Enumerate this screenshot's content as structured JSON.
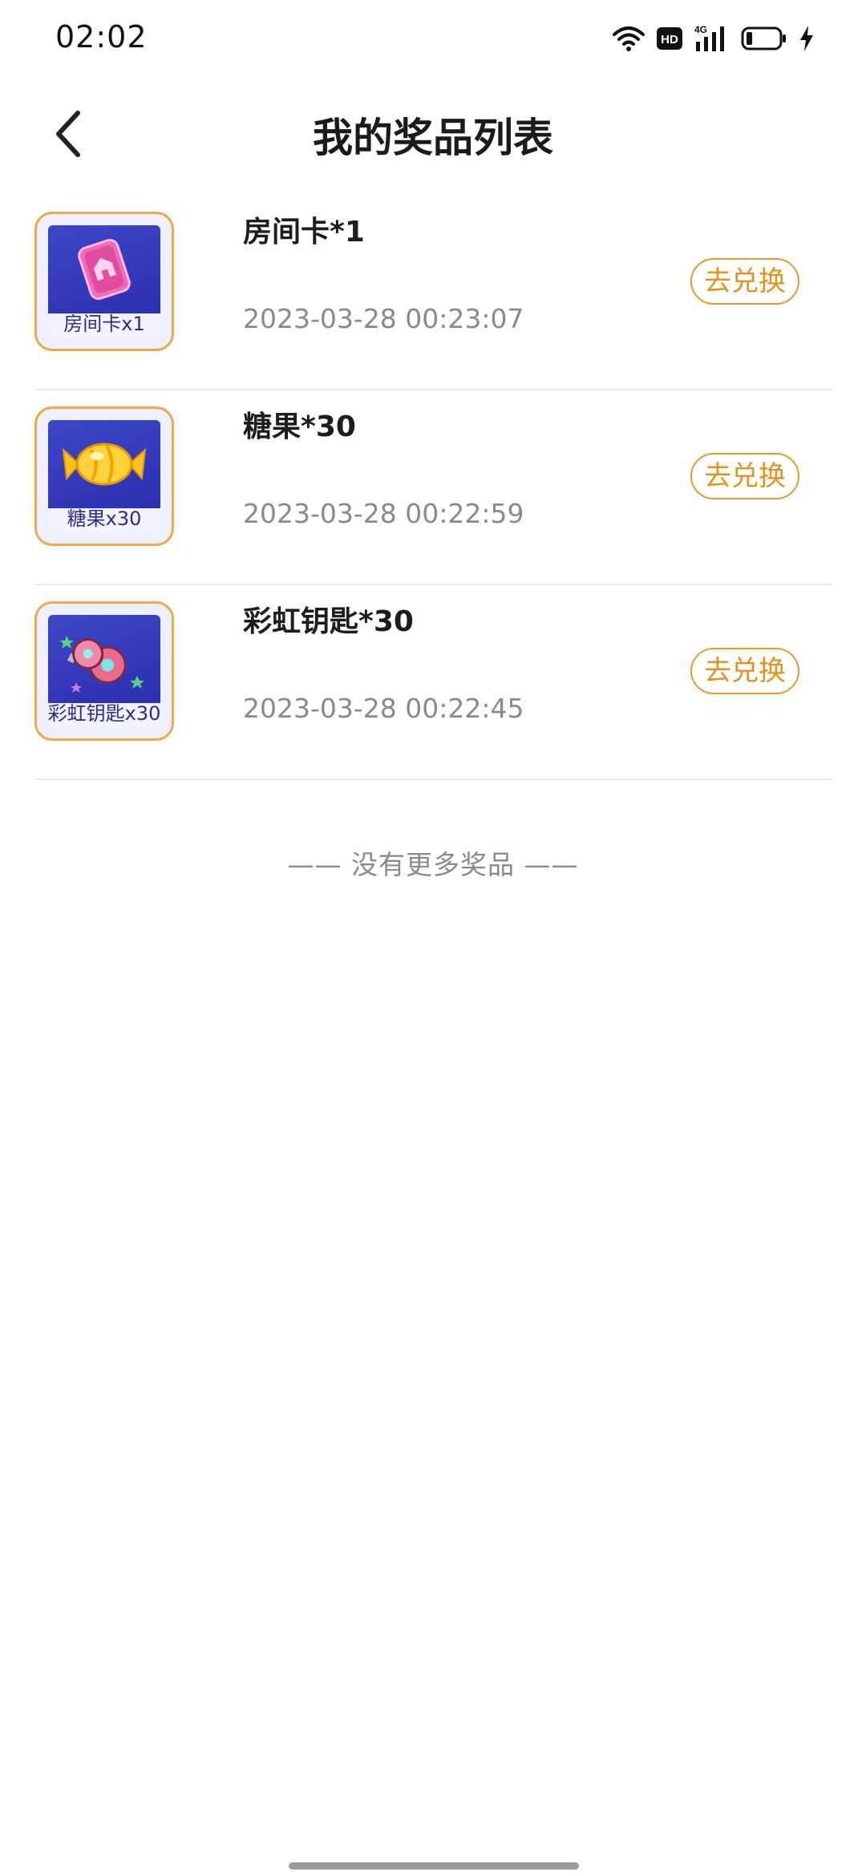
{
  "status_bar": {
    "time": "02:02",
    "icons": [
      "wifi-icon",
      "hd-icon",
      "signal-4g-icon",
      "battery-icon",
      "charging-icon"
    ],
    "hd_label": "HD",
    "network_label": "4G"
  },
  "header": {
    "back_icon": "chevron-left-icon",
    "title": "我的奖品列表"
  },
  "prizes": [
    {
      "name": "房间卡*1",
      "thumb_caption": "房间卡x1",
      "time": "2023-03-28 00:23:07",
      "action": "去兑换",
      "icon": "room-card-icon"
    },
    {
      "name": "糖果*30",
      "thumb_caption": "糖果x30",
      "time": "2023-03-28 00:22:59",
      "action": "去兑换",
      "icon": "candy-icon"
    },
    {
      "name": "彩虹钥匙*30",
      "thumb_caption": "彩虹钥匙x30",
      "time": "2023-03-28 00:22:45",
      "action": "去兑换",
      "icon": "rainbow-key-icon"
    }
  ],
  "footer_text": "—— 没有更多奖品 ——",
  "colors": {
    "accent": "#e4921f",
    "thumb_border": "#efa84a",
    "thumb_bg": "#3e47c9",
    "divider": "#e9e9e9",
    "secondary_text": "#8a8a8a"
  }
}
